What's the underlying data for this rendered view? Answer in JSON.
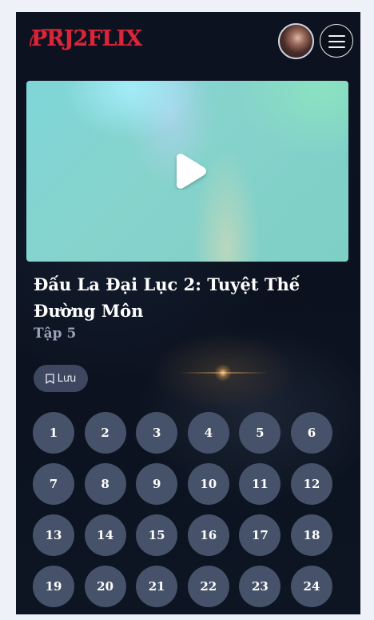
{
  "header": {
    "logo_text": "PRJ2FLIX",
    "logo_color": "#d8263a"
  },
  "player": {
    "play_icon": "play-icon"
  },
  "movie": {
    "title": "Đấu La Đại Lục 2: Tuyệt Thế Đường Môn",
    "episode": "Tập 5"
  },
  "actions": {
    "save_label": "Lưu",
    "save_icon": "bookmark-icon"
  },
  "episodes": [
    "1",
    "2",
    "3",
    "4",
    "5",
    "6",
    "7",
    "8",
    "9",
    "10",
    "11",
    "12",
    "13",
    "14",
    "15",
    "16",
    "17",
    "18",
    "19",
    "20",
    "21",
    "22",
    "23",
    "24"
  ],
  "colors": {
    "background": "#0c1220",
    "episode_button": "#465269",
    "save_button": "#3d4860",
    "episode_label": "#9aa4b6"
  }
}
